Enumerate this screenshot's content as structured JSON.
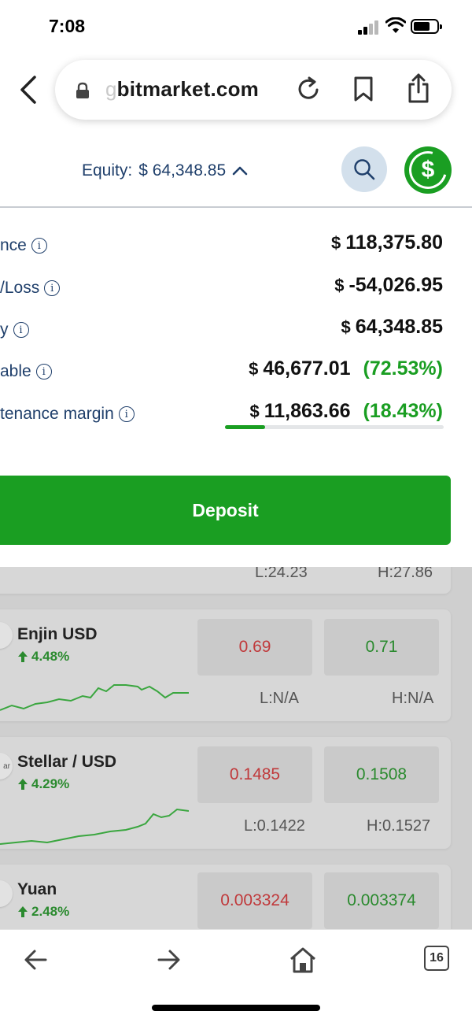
{
  "status": {
    "time": "7:08"
  },
  "browser": {
    "url_faded": "g",
    "url_main": "bitmarket.com",
    "tabs_count": "16"
  },
  "header": {
    "equity_label": "Equity:",
    "equity_value": "$ 64,348.85"
  },
  "account": {
    "rows": [
      {
        "label": "nce",
        "currency": "$",
        "value": "118,375.80",
        "pct": ""
      },
      {
        "label": "/Loss",
        "currency": "$",
        "value": "-54,026.95",
        "pct": ""
      },
      {
        "label": "y",
        "currency": "$",
        "value": "64,348.85",
        "pct": ""
      },
      {
        "label": "able",
        "currency": "$",
        "value": "46,677.01",
        "pct": "(72.53%)"
      },
      {
        "label": "tenance margin",
        "currency": "$",
        "value": "11,863.66",
        "pct": "(18.43%)"
      }
    ],
    "margin_fraction": 0.1843,
    "deposit_label": "Deposit"
  },
  "instruments": [
    {
      "name": "",
      "change": "",
      "bid": "",
      "ask": "",
      "low": "L:24.23",
      "high": "H:27.86"
    },
    {
      "name": "Enjin USD",
      "change": "4.48%",
      "bid": "0.69",
      "ask": "0.71",
      "low": "L:N/A",
      "high": "H:N/A",
      "icon_text": ""
    },
    {
      "name": "Stellar / USD",
      "change": "4.29%",
      "bid": "0.1485",
      "ask": "0.1508",
      "low": "L:0.1422",
      "high": "H:0.1527",
      "icon_text": "ar"
    },
    {
      "name": "Yuan",
      "change": "2.48%",
      "bid": "0.003324",
      "ask": "0.003374",
      "low": "",
      "high": "",
      "icon_text": ""
    }
  ],
  "colors": {
    "accent_green": "#1a9e22",
    "navy": "#1f3f6b",
    "bid_red": "#c0393b"
  }
}
